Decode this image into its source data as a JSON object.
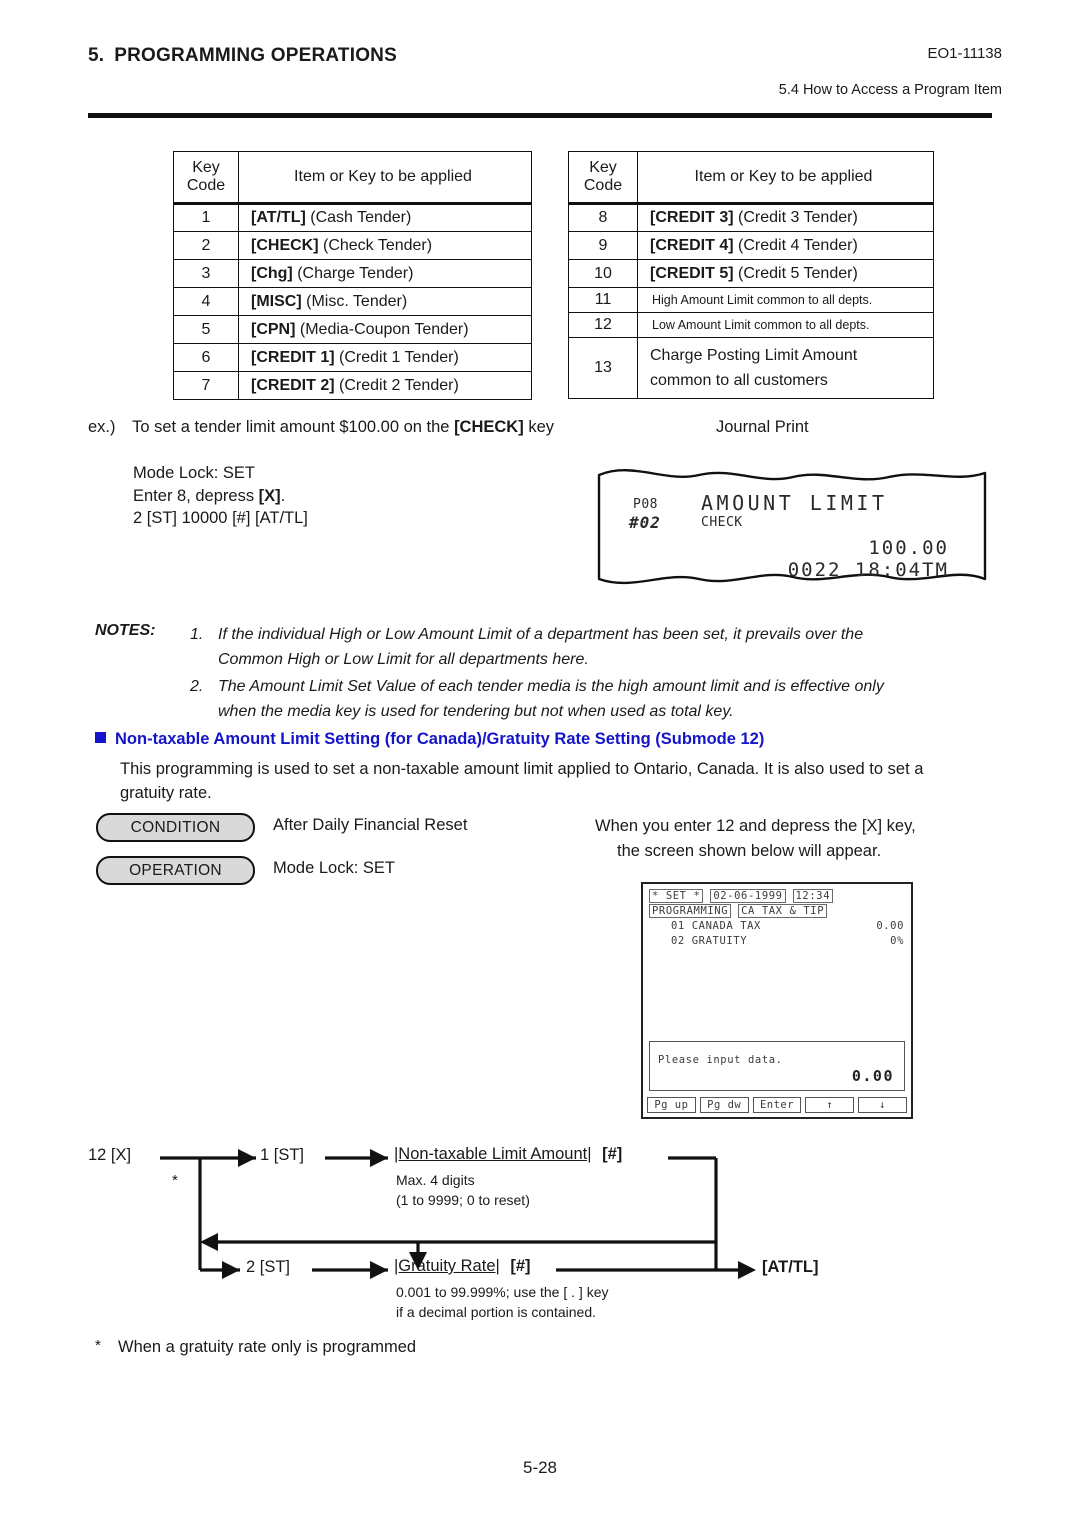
{
  "header": {
    "section_number": "5.",
    "section_title": "PROGRAMMING OPERATIONS",
    "doc_code": "EO1-11138",
    "subsection": "5.4  How to Access a Program Item"
  },
  "table_left": {
    "col_head_code": "Key Code",
    "col_head_code_l1": "Key",
    "col_head_code_l2": "Code",
    "col_head_item": "Item or Key to be applied",
    "rows": [
      {
        "code": "1",
        "key": "[AT/TL]",
        "desc": "(Cash Tender)"
      },
      {
        "code": "2",
        "key": "[CHECK]",
        "desc": "(Check Tender)"
      },
      {
        "code": "3",
        "key": "[Chg]",
        "desc": "(Charge Tender)"
      },
      {
        "code": "4",
        "key": "[MISC]",
        "desc": "(Misc. Tender)"
      },
      {
        "code": "5",
        "key": "[CPN]",
        "desc": "(Media-Coupon Tender)"
      },
      {
        "code": "6",
        "key": "[CREDIT 1]",
        "desc": "(Credit 1 Tender)"
      },
      {
        "code": "7",
        "key": "[CREDIT 2]",
        "desc": "(Credit 2 Tender)"
      }
    ]
  },
  "table_right": {
    "col_head_code_l1": "Key",
    "col_head_code_l2": "Code",
    "col_head_item": "Item or Key to be applied",
    "rows": [
      {
        "code": "8",
        "key": "[CREDIT 3]",
        "desc": "(Credit 3 Tender)",
        "small": false
      },
      {
        "code": "9",
        "key": "[CREDIT 4]",
        "desc": "(Credit 4 Tender)",
        "small": false
      },
      {
        "code": "10",
        "key": "[CREDIT 5]",
        "desc": "(Credit 5 Tender)",
        "small": false
      },
      {
        "code": "11",
        "key": "",
        "desc": "High Amount Limit common to all depts.",
        "small": true
      },
      {
        "code": "12",
        "key": "",
        "desc": "Low Amount Limit common to all depts.",
        "small": true
      },
      {
        "code": "13",
        "key": "",
        "desc": "Charge Posting Limit Amount common to all customers",
        "small": false
      }
    ],
    "row13_line1": "Charge Posting Limit Amount",
    "row13_line2": "common to all customers"
  },
  "example": {
    "prefix": "ex.)",
    "text_a": "To set a tender limit amount $100.00 on the ",
    "key": "[CHECK]",
    "text_b": " key",
    "line1": "Mode Lock:  SET",
    "line2_a": "Enter 8, depress ",
    "line2_key": "[X]",
    "line2_b": ".",
    "line3": "2 [ST]  10000 [#]  [AT/TL]",
    "journal_label": "Journal Print"
  },
  "journal": {
    "p_code": "P08",
    "hash_code": "#02",
    "title": "AMOUNT LIMIT",
    "media": "CHECK",
    "amount": "100.00",
    "counter_time": "0022 18:04TM"
  },
  "notes": {
    "label": "NOTES:",
    "items": [
      {
        "n": "1.",
        "line1": "If the individual High or Low Amount Limit of a department has been set, it prevails over the",
        "line2": "Common High or Low Limit for all departments here."
      },
      {
        "n": "2.",
        "line1": "The Amount Limit Set Value of each tender media is the high amount limit and is effective only",
        "line2": "when the media key is used for tendering but not when used as total key."
      }
    ]
  },
  "blue_section": {
    "heading": "Non-taxable Amount Limit Setting (for Canada)/Gratuity Rate Setting  (Submode 12)",
    "accent_color": "#1414c8",
    "body_line1": "This programming is used to set a non-taxable amount limit applied to Ontario, Canada. It is also used to set a",
    "body_line2": "gratuity rate."
  },
  "condition_block": {
    "condition_label": "CONDITION",
    "condition_text": "After Daily Financial Reset",
    "operation_label": "OPERATION",
    "operation_text": "Mode Lock:  SET",
    "right_line1": "When you enter 12 and depress the [X] key,",
    "right_line2": "the screen shown below will appear."
  },
  "lcd": {
    "mode": "* SET *",
    "date": "02-06-1999",
    "time": "12:34",
    "tag_programming": "PROGRAMMING",
    "tag_submode": "CA TAX & TIP",
    "rows": [
      {
        "label": "01 CANADA TAX",
        "value": "0.00"
      },
      {
        "label": "02 GRATUITY",
        "value": "0%"
      }
    ],
    "input_message": "Please input data.",
    "input_value": "0.00",
    "keys": [
      "Pg up",
      "Pg dw",
      "Enter",
      "↑",
      "↓"
    ]
  },
  "flow": {
    "start": "12 [X]",
    "branch_star": "*",
    "step1": "1 [ST]",
    "step1_field": "|Non-taxable Limit Amount|",
    "step1_hash": "[#]",
    "step1_note1": "Max. 4 digits",
    "step1_note2": "(1 to 9999; 0 to reset)",
    "step2": "2 [ST]",
    "step2_field": "|Gratuity Rate|",
    "step2_hash": "[#]",
    "step2_note1": "0.001 to 99.999%; use the [ . ] key",
    "step2_note2": "if a decimal portion is contained.",
    "end": "[AT/TL]"
  },
  "footnote": {
    "star": "*",
    "text": "When a gratuity rate only is programmed"
  },
  "page_number": "5-28"
}
